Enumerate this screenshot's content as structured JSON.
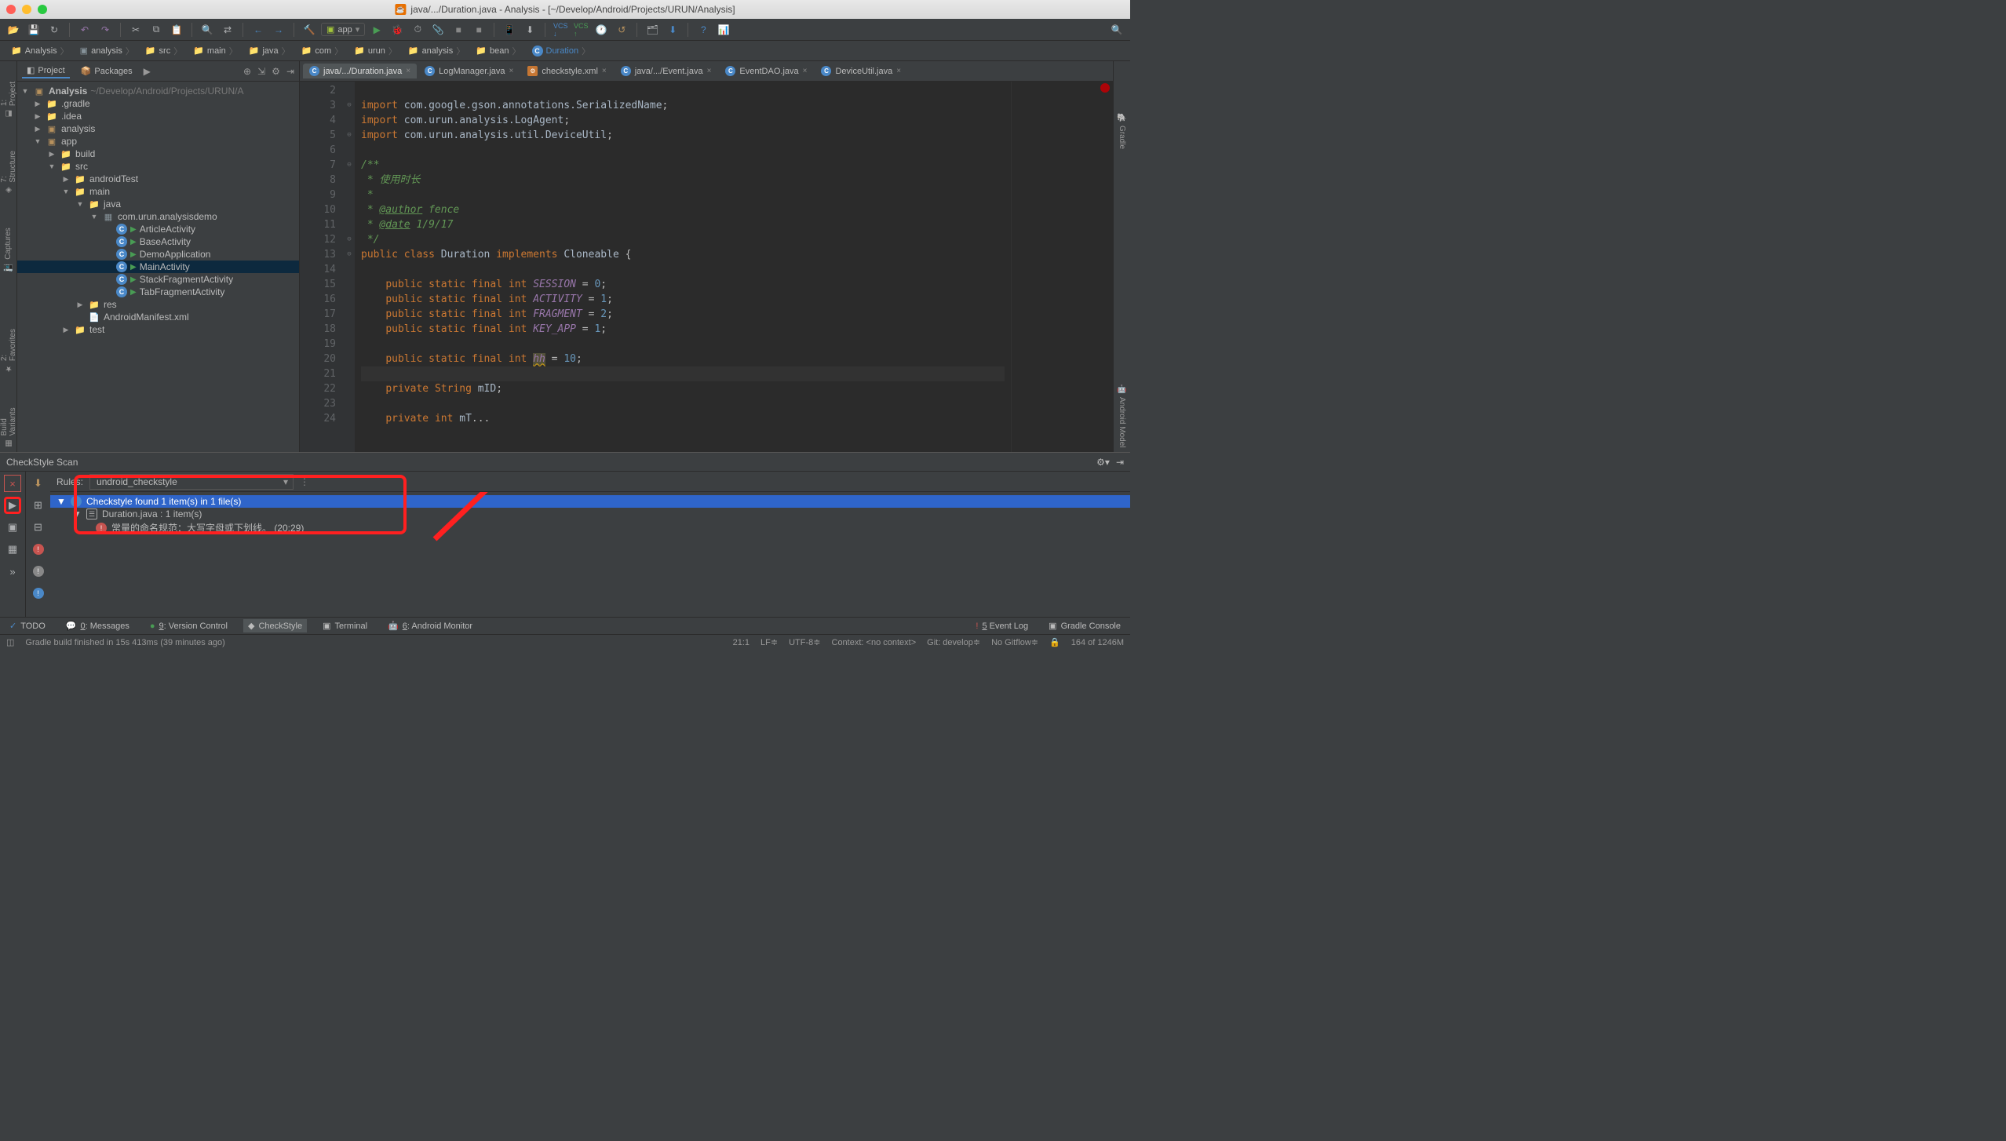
{
  "window": {
    "title": "java/.../Duration.java - Analysis - [~/Develop/Android/Projects/URUN/Analysis]"
  },
  "toolbar": {
    "run_config": "app"
  },
  "breadcrumbs": [
    {
      "icon": "project",
      "label": "Analysis"
    },
    {
      "icon": "module",
      "label": "analysis"
    },
    {
      "icon": "folder",
      "label": "src"
    },
    {
      "icon": "folder",
      "label": "main"
    },
    {
      "icon": "folder",
      "label": "java"
    },
    {
      "icon": "folder",
      "label": "com"
    },
    {
      "icon": "folder",
      "label": "urun"
    },
    {
      "icon": "folder",
      "label": "analysis"
    },
    {
      "icon": "folder",
      "label": "bean"
    },
    {
      "icon": "class",
      "label": "Duration"
    }
  ],
  "project_tabs": {
    "project": "Project",
    "packages": "Packages"
  },
  "project_tree": {
    "root_name": "Analysis",
    "root_path": "~/Develop/Android/Projects/URUN/A",
    "items": [
      {
        "depth": 0,
        "exp": "▶",
        "ic": "folder",
        "label": ".gradle"
      },
      {
        "depth": 0,
        "exp": "▶",
        "ic": "folder",
        "label": ".idea"
      },
      {
        "depth": 0,
        "exp": "▶",
        "ic": "module",
        "label": "analysis"
      },
      {
        "depth": 0,
        "exp": "▼",
        "ic": "module",
        "label": "app"
      },
      {
        "depth": 1,
        "exp": "▶",
        "ic": "folder",
        "label": "build"
      },
      {
        "depth": 1,
        "exp": "▼",
        "ic": "folder",
        "label": "src"
      },
      {
        "depth": 2,
        "exp": "▶",
        "ic": "folder",
        "label": "androidTest"
      },
      {
        "depth": 2,
        "exp": "▼",
        "ic": "folder",
        "label": "main"
      },
      {
        "depth": 3,
        "exp": "▼",
        "ic": "folder",
        "label": "java"
      },
      {
        "depth": 4,
        "exp": "▼",
        "ic": "package",
        "label": "com.urun.analysisdemo"
      },
      {
        "depth": 5,
        "exp": "",
        "ic": "class",
        "label": "ArticleActivity",
        "runnable": true
      },
      {
        "depth": 5,
        "exp": "",
        "ic": "class",
        "label": "BaseActivity",
        "runnable": true
      },
      {
        "depth": 5,
        "exp": "",
        "ic": "class",
        "label": "DemoApplication",
        "runnable": true
      },
      {
        "depth": 5,
        "exp": "",
        "ic": "class",
        "label": "MainActivity",
        "runnable": true,
        "selected": true
      },
      {
        "depth": 5,
        "exp": "",
        "ic": "class",
        "label": "StackFragmentActivity",
        "runnable": true
      },
      {
        "depth": 5,
        "exp": "",
        "ic": "class",
        "label": "TabFragmentActivity",
        "runnable": true
      },
      {
        "depth": 3,
        "exp": "▶",
        "ic": "folder",
        "label": "res"
      },
      {
        "depth": 3,
        "exp": "",
        "ic": "xml",
        "label": "AndroidManifest.xml"
      },
      {
        "depth": 2,
        "exp": "▶",
        "ic": "folder",
        "label": "test"
      }
    ]
  },
  "editor": {
    "tabs": [
      {
        "icon": "class",
        "label": "java/.../Duration.java",
        "active": true
      },
      {
        "icon": "class",
        "label": "LogManager.java"
      },
      {
        "icon": "xml",
        "label": "checkstyle.xml"
      },
      {
        "icon": "class",
        "label": "java/.../Event.java"
      },
      {
        "icon": "class",
        "label": "EventDAO.java"
      },
      {
        "icon": "class",
        "label": "DeviceUtil.java"
      }
    ],
    "first_line": 2,
    "lines": [
      "",
      "import com.google.gson.annotations.SerializedName;",
      "import com.urun.analysis.LogAgent;",
      "import com.urun.analysis.util.DeviceUtil;",
      "",
      "/**",
      " * 使用时长",
      " *",
      " * @author fence",
      " * @date 1/9/17",
      " */",
      "public class Duration implements Cloneable {",
      "",
      "    public static final int SESSION = 0;",
      "    public static final int ACTIVITY = 1;",
      "    public static final int FRAGMENT = 2;",
      "    public static final int KEY_APP = 1;",
      "",
      "    public static final int hh = 10;",
      "",
      "    private String mID;",
      "",
      "    private int mT..."
    ]
  },
  "checkstyle": {
    "panel_title": "CheckStyle Scan",
    "rules_label": "Rules:",
    "rules_value": "undroid_checkstyle",
    "results": {
      "summary": "Checkstyle found 1 item(s) in 1 file(s)",
      "file": "Duration.java : 1 item(s)",
      "issue": "常量的命名规范：大写字母或下划线。 (20:29)"
    }
  },
  "bottom_tabs": {
    "todo": "TODO",
    "messages": "0: Messages",
    "vcs": "9: Version Control",
    "checkstyle": "CheckStyle",
    "terminal": "Terminal",
    "android": "6: Android Monitor",
    "event_log": "5 Event Log",
    "gradle_console": "Gradle Console"
  },
  "status": {
    "message": "Gradle build finished in 15s 413ms (39 minutes ago)",
    "cursor": "21:1",
    "line_sep": "LF≑",
    "encoding": "UTF-8≑",
    "context": "Context: <no context>",
    "git": "Git: develop≑",
    "gitflow": "No Gitflow≑",
    "memory": "164 of 1246M"
  },
  "left_tools": [
    "1: Project",
    "7: Structure",
    "Captures"
  ],
  "left_tools_bottom": [
    "2: Favorites",
    "Build Variants"
  ],
  "right_tools": [
    "Gradle",
    "Android Model"
  ]
}
